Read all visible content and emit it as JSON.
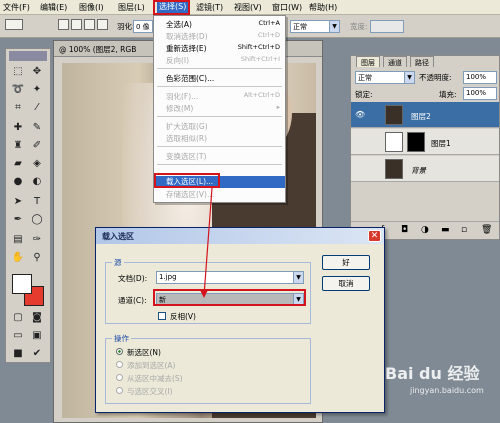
{
  "menubar": {
    "items": [
      "文件(F)",
      "编辑(E)",
      "图像(I)",
      "图层(L)",
      "选择(S)",
      "滤镜(T)",
      "视图(V)",
      "窗口(W)",
      "帮助(H)"
    ]
  },
  "options_bar": {
    "feather_label": "羽化:",
    "feather_value": "0 像",
    "width_label": "宽度:",
    "mode_value": "正常"
  },
  "document": {
    "title": "@ 100% (图层2, RGB"
  },
  "select_menu": {
    "items": [
      {
        "label": "全选(A)",
        "shortcut": "Ctrl+A",
        "state": "enabled"
      },
      {
        "label": "取消选择(D)",
        "shortcut": "Ctrl+D",
        "state": "disabled"
      },
      {
        "label": "重新选择(E)",
        "shortcut": "Shift+Ctrl+D",
        "state": "enabled"
      },
      {
        "label": "反向(I)",
        "shortcut": "Shift+Ctrl+I",
        "state": "disabled"
      },
      {
        "label": "色彩范围(C)...",
        "shortcut": "",
        "state": "enabled"
      },
      {
        "label": "羽化(F)...",
        "shortcut": "Alt+Ctrl+D",
        "state": "disabled"
      },
      {
        "label": "修改(M)",
        "shortcut": "",
        "state": "disabled"
      },
      {
        "label": "扩大选取(G)",
        "shortcut": "",
        "state": "disabled"
      },
      {
        "label": "选取相似(R)",
        "shortcut": "",
        "state": "disabled"
      },
      {
        "label": "变换选区(T)",
        "shortcut": "",
        "state": "disabled"
      },
      {
        "label": "载入选区(L)...",
        "shortcut": "",
        "state": "highlighted"
      },
      {
        "label": "存储选区(V)...",
        "shortcut": "",
        "state": "disabled"
      }
    ]
  },
  "layers_panel": {
    "tabs": [
      "图层",
      "通道",
      "路径"
    ],
    "blend_mode": "正常",
    "opacity_label": "不透明度:",
    "opacity_value": "100%",
    "lock_label": "锁定:",
    "fill_label": "填充:",
    "fill_value": "100%",
    "layers": [
      "图层2",
      "图层1",
      "背景"
    ]
  },
  "dialog": {
    "title": "载入选区",
    "source_group": "源",
    "document_label": "文档(D):",
    "document_value": "1.jpg",
    "channel_label": "通道(C):",
    "channel_value": "新",
    "invert_label": "反相(V)",
    "operation_group": "操作",
    "operations": [
      "新选区(N)",
      "添加到选区(A)",
      "从选区中减去(S)",
      "与选区交叉(I)"
    ],
    "ok_label": "好",
    "cancel_label": "取消"
  },
  "watermark": {
    "brand": "Bai du 经验",
    "url": "jingyan.baidu.com"
  },
  "colors": {
    "highlight_red": "#d4141c",
    "menu_highlight": "#316ac5",
    "foreground_swatch": "#ffffff",
    "background_swatch": "#e53a2e"
  }
}
